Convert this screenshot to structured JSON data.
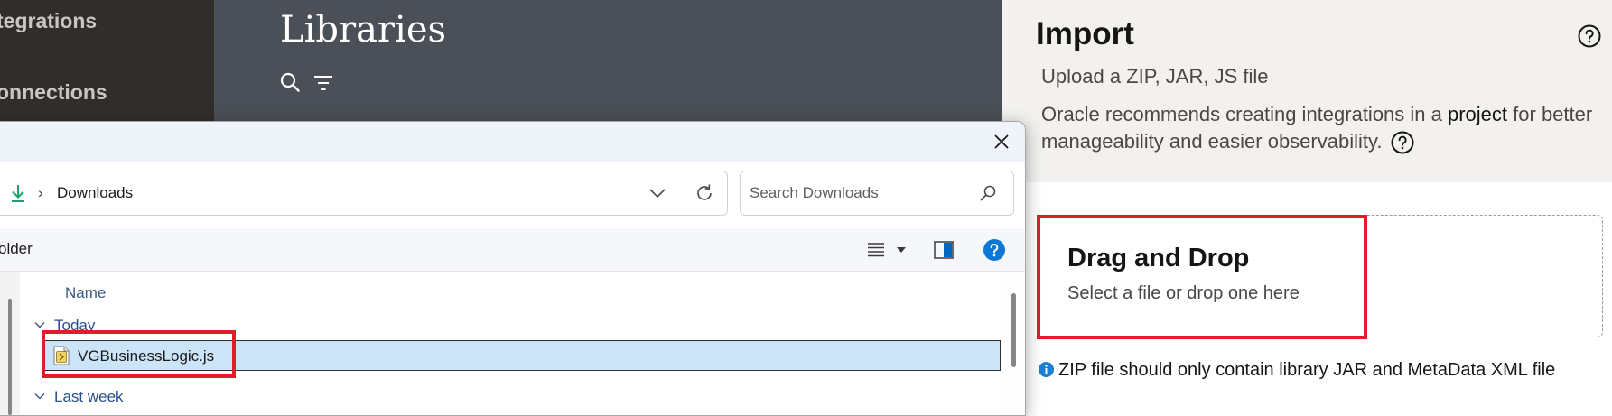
{
  "left_nav": {
    "items": [
      {
        "label": "Integrations",
        "visible_text": "tegrations"
      },
      {
        "label": "Connections",
        "visible_text": "onnections"
      }
    ]
  },
  "libraries_page": {
    "title": "Libraries",
    "icons": [
      "search-icon",
      "filter-icon"
    ]
  },
  "import_drawer": {
    "title": "Import",
    "subtitle": "Upload a ZIP, JAR, JS file",
    "recommendation_prefix": "Oracle recommends creating integrations in a ",
    "recommendation_link": "project",
    "recommendation_suffix": " for better manageability and easier observability.",
    "drop_title": "Drag and Drop",
    "drop_subtitle": "Select a file or drop one here",
    "info_text": "ZIP file should only contain library JAR and MetaData XML file",
    "highlight_color": "#e01e2b"
  },
  "file_dialog": {
    "address": {
      "separator": "›",
      "folder": "Downloads"
    },
    "search_placeholder": "Search Downloads",
    "command_bar": {
      "new_folder_label": "older"
    },
    "list": {
      "column_header": "Name",
      "groups": [
        {
          "label": "Today",
          "files": [
            "VGBusinessLogic.js"
          ]
        },
        {
          "label": "Last week",
          "files": []
        }
      ],
      "selected_file": "VGBusinessLogic.js"
    }
  },
  "colors": {
    "left_nav_bg": "#312d2a",
    "page_bg": "#4b4f57",
    "drawer_header_bg": "#f2f1ef",
    "selection_bg": "#cce4f7",
    "info_blue": "#1a7fd4"
  }
}
